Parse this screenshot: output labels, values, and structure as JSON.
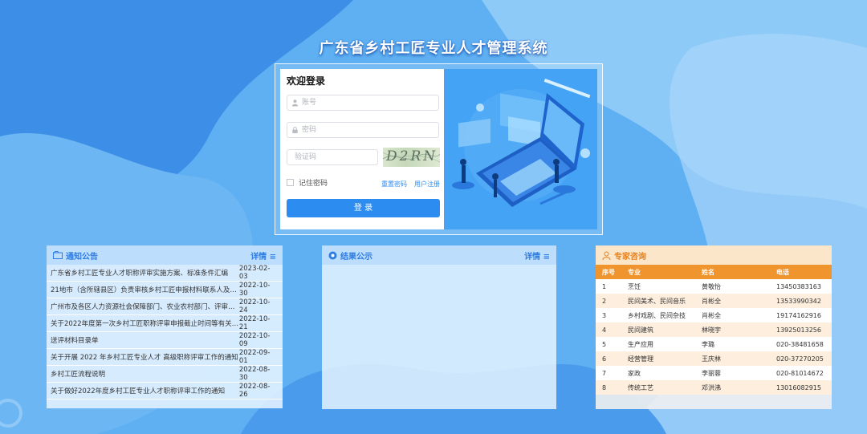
{
  "app": {
    "title": "广东省乡村工匠专业人才管理系统"
  },
  "login": {
    "heading": "欢迎登录",
    "account_placeholder": "账号",
    "password_placeholder": "密码",
    "captcha_placeholder": "验证码",
    "captcha_text": "D2RN",
    "remember_label": "记住密码",
    "reset_link": "重置密码",
    "register_link": "用户注册",
    "submit_label": "登 录"
  },
  "notice": {
    "title": "通知公告",
    "more_label": "详情 ≡",
    "items": [
      {
        "title": "广东省乡村工匠专业人才职称评审实施方案、标准条件汇编",
        "date": "2023-02-03"
      },
      {
        "title": "21地市（含所辖县区）负责审核乡村工匠申报材料联系人及联系方式",
        "date": "2022-10-30"
      },
      {
        "title": "广州市及各区人力资源社会保障部门、农业农村部门、评审机构联系方式",
        "date": "2022-10-24"
      },
      {
        "title": "关于2022年度第一次乡村工匠职称评审申报截止时间等有关事项的通知",
        "date": "2022-10-21"
      },
      {
        "title": "送评材料目录单",
        "date": "2022-10-09"
      },
      {
        "title": "关于开展 2022 年乡村工匠专业人才 高级职称评审工作的通知",
        "date": "2022-09-01"
      },
      {
        "title": "乡村工匠流程说明",
        "date": "2022-08-30"
      },
      {
        "title": "关于做好2022年度乡村工匠专业人才职称评审工作的通知",
        "date": "2022-08-26"
      }
    ]
  },
  "result": {
    "title": "结果公示",
    "more_label": "详情 ≡"
  },
  "expert": {
    "title": "专家咨询",
    "columns": [
      "序号",
      "专业",
      "姓名",
      "电话"
    ],
    "rows": [
      [
        "1",
        "烹饪",
        "黄敬怡",
        "13450383163"
      ],
      [
        "2",
        "民间美术、民间音乐",
        "肖彬全",
        "13533990342"
      ],
      [
        "3",
        "乡村戏剧、民间杂技",
        "肖彬全",
        "19174162916"
      ],
      [
        "4",
        "民间建筑",
        "林晓宇",
        "13925013256"
      ],
      [
        "5",
        "生产应用",
        "李璐",
        "020-38481658"
      ],
      [
        "6",
        "经营管理",
        "王庆林",
        "020-37270205"
      ],
      [
        "7",
        "家政",
        "李丽蓉",
        "020-81014672"
      ],
      [
        "8",
        "传统工艺",
        "邓洪沸",
        "13016082915"
      ]
    ]
  },
  "colors": {
    "primary": "#2d8cf0",
    "expert_accent": "#f0952e",
    "background": "#5ba9ef"
  }
}
